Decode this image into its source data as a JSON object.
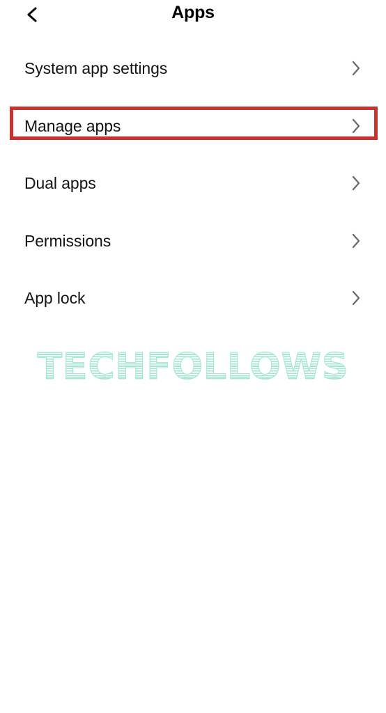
{
  "appbar": {
    "back_icon": "chevron-left-icon",
    "title": "Apps"
  },
  "list": {
    "chevron_icon": "chevron-right-icon",
    "items": [
      {
        "label": "System app settings",
        "highlighted": false
      },
      {
        "label": "Manage apps",
        "highlighted": true
      },
      {
        "label": "Dual apps",
        "highlighted": false
      },
      {
        "label": "Permissions",
        "highlighted": false
      },
      {
        "label": "App lock",
        "highlighted": false
      }
    ]
  },
  "annotation": {
    "highlight_target": "Manage apps",
    "highlight_color": "#c8322f"
  },
  "watermark": {
    "text": "TECHFOLLOWS",
    "color": "#a2e8d1"
  },
  "colors": {
    "background": "#ffffff",
    "text": "#131313",
    "chevron": "#6b6b6b",
    "accent_red": "#c8322f",
    "watermark_mint": "#a2e8d1"
  }
}
